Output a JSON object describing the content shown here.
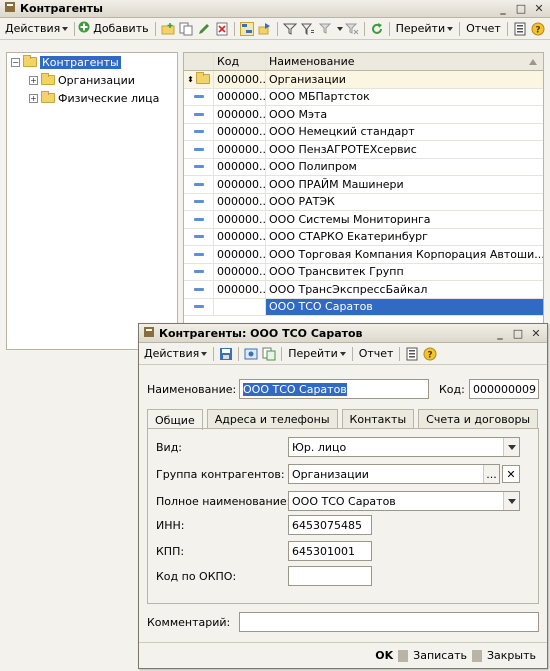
{
  "main": {
    "title": "Контрагенты",
    "toolbar": {
      "actions_label": "Действия",
      "add_label": "Добавить",
      "goto_label": "Перейти",
      "report_label": "Отчет"
    },
    "tree": {
      "root_label": "Контрагенты",
      "children": [
        "Организации",
        "Физические лица"
      ]
    },
    "grid": {
      "columns": [
        "Код",
        "Наименование"
      ],
      "group_row": {
        "code": "000000...",
        "name": "Организации"
      },
      "rows": [
        {
          "code": "000000...",
          "name": "ООО МБПартсток"
        },
        {
          "code": "000000...",
          "name": "ООО Мэта"
        },
        {
          "code": "000000...",
          "name": "ООО Немецкий стандарт"
        },
        {
          "code": "000000...",
          "name": "ООО ПензАГРОТЕХсервис"
        },
        {
          "code": "000000...",
          "name": "ООО Полипром"
        },
        {
          "code": "000000...",
          "name": "ООО ПРАЙМ Машинери"
        },
        {
          "code": "000000...",
          "name": "ООО РАТЭК"
        },
        {
          "code": "000000...",
          "name": "ООО Системы Мониторинга"
        },
        {
          "code": "000000...",
          "name": "ООО СТАРКО Екатеринбург"
        },
        {
          "code": "000000...",
          "name": "ООО Торговая Компания Корпорация Автоши..."
        },
        {
          "code": "000000...",
          "name": "ООО Трансвитек Групп"
        },
        {
          "code": "000000...",
          "name": "ООО ТрансЭкспрессБайкал"
        },
        {
          "code": "",
          "name": "ООО ТСО Саратов"
        }
      ]
    }
  },
  "dialog": {
    "title": "Контрагенты: ООО ТСО Саратов",
    "toolbar": {
      "actions_label": "Действия",
      "goto_label": "Перейти",
      "report_label": "Отчет"
    },
    "name_label": "Наименование:",
    "name_value": "ООО ТСО Саратов",
    "code_label": "Код:",
    "code_value": "000000009",
    "tabs": [
      "Общие",
      "Адреса и телефоны",
      "Контакты",
      "Счета и договоры"
    ],
    "kind_label": "Вид:",
    "kind_value": "Юр. лицо",
    "group_label": "Группа контрагентов:",
    "group_value": "Организации",
    "fullname_label": "Полное наименование:",
    "fullname_value": "ООО ТСО Саратов",
    "inn_label": "ИНН:",
    "inn_value": "6453075485",
    "kpp_label": "КПП:",
    "kpp_value": "645301001",
    "okpo_label": "Код по ОКПО:",
    "okpo_value": "",
    "comment_label": "Комментарий:",
    "comment_value": "",
    "buttons": {
      "ok": "OK",
      "save": "Записать",
      "close": "Закрыть"
    }
  },
  "colors": {
    "selection": "#316ac5",
    "folder": "#f2d36a",
    "window_bg": "#f4f2ec"
  }
}
